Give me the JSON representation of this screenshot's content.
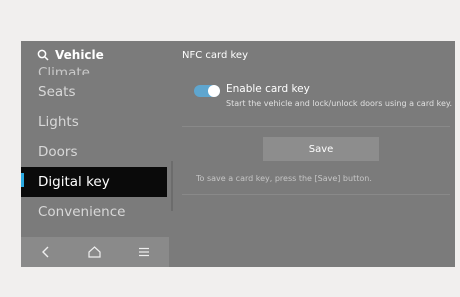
{
  "sidebar": {
    "title": "Vehicle",
    "items": [
      {
        "label": "Climate"
      },
      {
        "label": "Seats"
      },
      {
        "label": "Lights"
      },
      {
        "label": "Doors"
      },
      {
        "label": "Digital key"
      },
      {
        "label": "Convenience"
      }
    ],
    "active_index": 4
  },
  "navbar": {
    "icons": [
      "back-icon",
      "home-icon",
      "menu-icon"
    ]
  },
  "content": {
    "title": "NFC card key",
    "toggle": {
      "label": "Enable card key",
      "description": "Start the vehicle and lock/unlock doors using a card key.",
      "enabled": true
    },
    "save_label": "Save",
    "hint": "To save a card key, press the [Save] button."
  },
  "colors": {
    "accent": "#29a8e0",
    "toggle_on": "#5fa6cf",
    "screen_bg": "#7b7b7b",
    "active_bg": "#0a0a0a"
  }
}
